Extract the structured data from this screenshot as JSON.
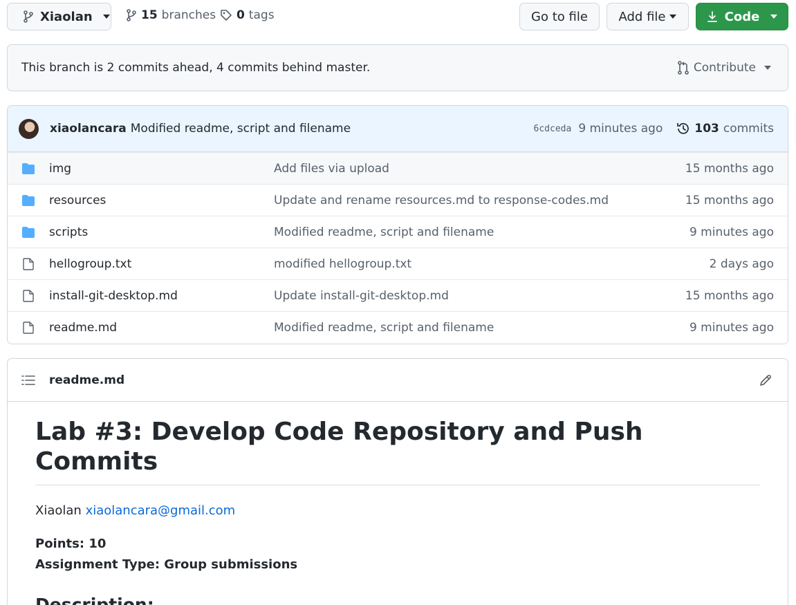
{
  "topbar": {
    "branch": "Xiaolan",
    "branches_count": "15",
    "branches_label": "branches",
    "tags_count": "0",
    "tags_label": "tags",
    "goto_file": "Go to file",
    "add_file": "Add file",
    "code": "Code"
  },
  "branch_status": {
    "text": "This branch is 2 commits ahead, 4 commits behind master.",
    "contribute": "Contribute"
  },
  "latest_commit": {
    "author": "xiaolancara",
    "message": "Modified readme, script and filename",
    "sha": "6cdceda",
    "time": "9 minutes ago",
    "count": "103",
    "count_label": "commits"
  },
  "files": [
    {
      "type": "folder",
      "name": "img",
      "message": "Add files via upload",
      "age": "15 months ago"
    },
    {
      "type": "folder",
      "name": "resources",
      "message": "Update and rename resources.md to response-codes.md",
      "age": "15 months ago"
    },
    {
      "type": "folder",
      "name": "scripts",
      "message": "Modified readme, script and filename",
      "age": "9 minutes ago"
    },
    {
      "type": "file",
      "name": "hellogroup.txt",
      "message": "modified hellogroup.txt",
      "age": "2 days ago"
    },
    {
      "type": "file",
      "name": "install-git-desktop.md",
      "message": "Update install-git-desktop.md",
      "age": "15 months ago"
    },
    {
      "type": "file",
      "name": "readme.md",
      "message": "Modified readme, script and filename",
      "age": "9 minutes ago"
    }
  ],
  "readme": {
    "filename": "readme.md",
    "heading": "Lab #3: Develop Code Repository and Push Commits",
    "author_name": "Xiaolan",
    "author_email": "xiaolancara@gmail.com",
    "points": "Points: 10",
    "assignment_type": "Assignment Type: Group submissions",
    "section": "Description:"
  },
  "colors": {
    "code_button": "#2c974b",
    "link": "#0969da",
    "folder_icon": "#54aeff",
    "commit_bar": "#eaf5ff"
  }
}
